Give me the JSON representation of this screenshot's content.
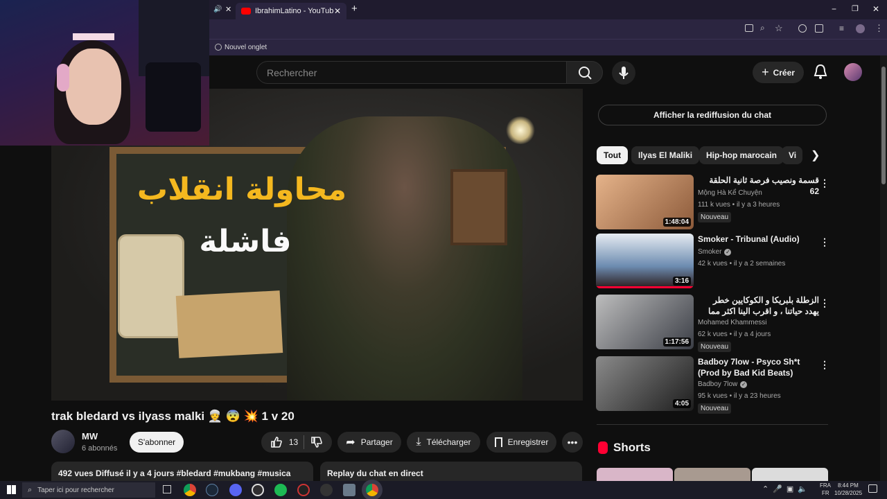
{
  "browser": {
    "tab_title": "IbrahimLatino - YouTube",
    "bookmark_label": "Nouvel onglet"
  },
  "header": {
    "search_placeholder": "Rechercher",
    "create_label": "Créer"
  },
  "video": {
    "thumbnail_text_line1": "محاولة انقلاب",
    "thumbnail_text_line2": "فاشلة",
    "title": "trak bledard vs ilyass malki 👳 😨 💥 1 v 20",
    "channel_name": "MW",
    "subscribers": "6 abonnés",
    "subscribe_label": "S'abonner",
    "likes": "13",
    "share_label": "Partager",
    "download_label": "Télécharger",
    "save_label": "Enregistrer",
    "description_summary": "492 vues  Diffusé il y a 4 jours  #bledard #mukbang #musica",
    "chat_replay_box": "Replay du chat en direct"
  },
  "sidebar": {
    "chat_replay_button": "Afficher la rediffusion du chat",
    "chips": [
      "Tout",
      "Ilyas El Maliki",
      "Hip-hop marocain",
      "Vi"
    ],
    "recommendations": [
      {
        "title": "قسمة ونصيب فرصة ثانية الحلقة 62",
        "channel": "Mộng Hà Kể Chuyện",
        "meta": "111 k vues • il y a 3 heures",
        "badge": "Nouveau",
        "duration": "1:48:04",
        "verified": false,
        "thumb_color": "#c98a5e"
      },
      {
        "title": "Smoker - Tribunal (Audio)",
        "channel": "Smoker",
        "meta": "42 k vues • il y a 2 semaines",
        "badge": "",
        "duration": "3:16",
        "verified": true,
        "thumb_color": "#2f4a66"
      },
      {
        "title": "الزطلة بلبريكا و الكوكايين خطر يهدد حياتنا ، و اقرب الينا اكثر مما نعتقد .. شهادات ...",
        "channel": "Mohamed Khammessi",
        "meta": "62 k vues • il y a 4 jours",
        "badge": "Nouveau",
        "duration": "1:17:56",
        "verified": false,
        "thumb_color": "#3d3b47"
      },
      {
        "title": "Badboy 7low - Psyco Sh*t (Prod by Bad Kid Beats)",
        "channel": "Badboy 7low",
        "meta": "95 k vues • il y a 23 heures",
        "badge": "Nouveau",
        "duration": "4:05",
        "verified": true,
        "thumb_color": "#555555"
      }
    ],
    "shorts_title": "Shorts"
  },
  "taskbar": {
    "search_placeholder": "Taper ici pour rechercher",
    "lang_top": "FRA",
    "lang_bottom": "FR",
    "time": "8:44 PM",
    "date": "10/28/2025"
  },
  "colors": {
    "background": "#0f0f0f",
    "chip_bg": "#272727",
    "accent_red": "#ff0033",
    "youtube_red": "#ff0000"
  }
}
